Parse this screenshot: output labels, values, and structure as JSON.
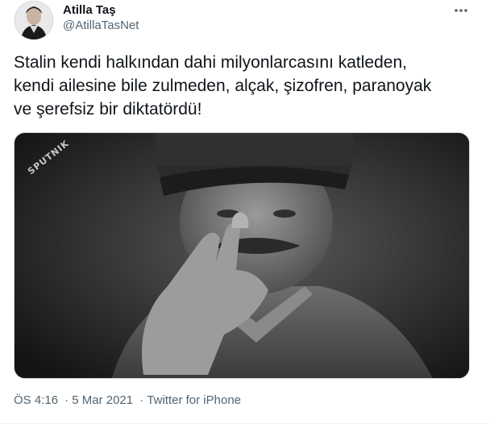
{
  "author": {
    "name": "Atilla Taş",
    "handle": "@AtillaTasNet"
  },
  "tweet": {
    "text": "Stalin kendi halkından dahi milyonlarcasını katleden,\nkendi ailesine bile zulmeden, alçak, şizofren, paranoyak\nve şerefsiz bir diktatördü!",
    "media": {
      "watermark": "SPUTNIK"
    },
    "time": "ÖS 4:16",
    "separator": "·",
    "date": "5 Mar 2021",
    "source": "Twitter for iPhone"
  },
  "icons": {
    "more": "more-horizontal-icon"
  },
  "colors": {
    "text": "#0f1419",
    "secondary": "#536471",
    "border": "#cfd9de"
  }
}
